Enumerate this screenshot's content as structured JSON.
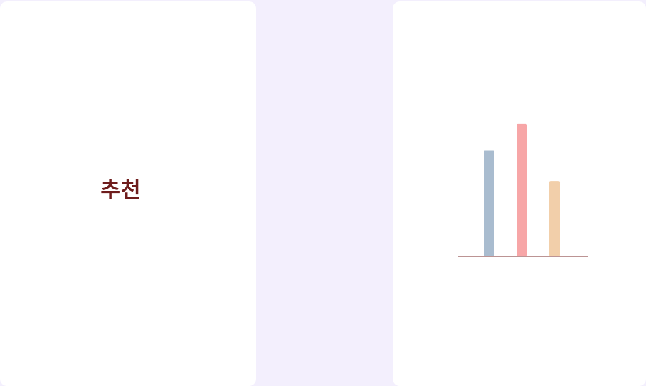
{
  "left_card": {
    "label": "추천"
  },
  "colors": {
    "background": "#f3effd",
    "card": "#ffffff",
    "label": "#6e1c1c",
    "baseline": "#7a2a2a"
  },
  "chart_data": {
    "type": "bar",
    "categories": [
      "",
      "",
      ""
    ],
    "values": [
      150,
      188,
      107
    ],
    "ylim": [
      0,
      200
    ],
    "grid": false,
    "colors": [
      "#a9bccf",
      "#f7a6a7",
      "#f2cfaa"
    ]
  }
}
